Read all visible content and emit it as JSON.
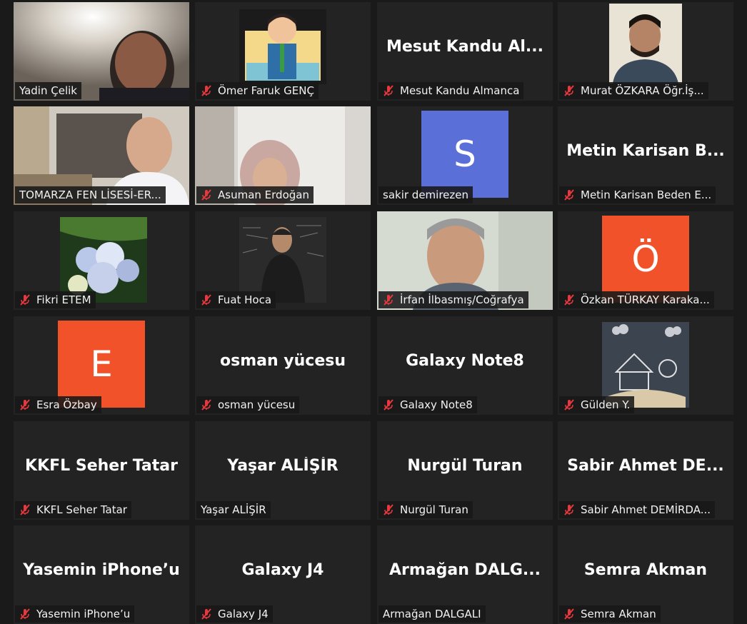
{
  "participants": [
    {
      "name": "Yadin Çelik",
      "muted": false,
      "active": true
    },
    {
      "name": "Ömer Faruk GENÇ",
      "muted": true
    },
    {
      "name": "Mesut Kandu Almanca",
      "display": "Mesut  Kandu  Al...",
      "muted": true
    },
    {
      "name": "Murat ÖZKARA Öğr.İş...",
      "muted": true
    },
    {
      "name": "TOMARZA FEN LİSESİ-ER...",
      "muted": false
    },
    {
      "name": "Asuman Erdoğan",
      "muted": true
    },
    {
      "name": "sakir demirezen",
      "avatar_letter": "S",
      "muted": false
    },
    {
      "name": "Metin Karisan Beden E...",
      "display": "Metin  Karisan  B...",
      "muted": true
    },
    {
      "name": "Fikri ETEM",
      "muted": true
    },
    {
      "name": "Fuat Hoca",
      "muted": true
    },
    {
      "name": "İrfan İlbasmış/Coğrafya",
      "muted": true
    },
    {
      "name": "Özkan TÜRKAY Karaka...",
      "avatar_letter": "Ö",
      "muted": true
    },
    {
      "name": "Esra Özbay",
      "avatar_letter": "E",
      "muted": true
    },
    {
      "name": "osman yücesu",
      "display": "osman yücesu",
      "muted": true
    },
    {
      "name": "Galaxy Note8",
      "display": "Galaxy Note8",
      "muted": true
    },
    {
      "name": "Gülden Y.",
      "muted": true
    },
    {
      "name": "KKFL Seher Tatar",
      "display": "KKFL Seher Tatar",
      "muted": true
    },
    {
      "name": "Yaşar ALİŞİR",
      "display": "Yaşar ALİŞİR",
      "muted": false
    },
    {
      "name": "Nurgül Turan",
      "display": "Nurgül Turan",
      "muted": true
    },
    {
      "name": "Sabir Ahmet DEMİRDA...",
      "display": "Sabir  Ahmet  DE...",
      "muted": true
    },
    {
      "name": "Yasemin iPhone’u",
      "display": "Yasemin iPhone’u",
      "muted": true
    },
    {
      "name": "Galaxy J4",
      "display": "Galaxy J4",
      "muted": true
    },
    {
      "name": "Armağan DALGALI",
      "display": "Armağan  DALG...",
      "muted": false
    },
    {
      "name": "Semra Akman",
      "display": "Semra Akman",
      "muted": true
    }
  ],
  "colors": {
    "active_speaker": "#d9e86f",
    "muted_icon": "#e8383d",
    "avatar_orange": "#f1522a",
    "avatar_blue": "#5b6fd8"
  },
  "icons": {
    "muted": "mic-muted-icon"
  }
}
